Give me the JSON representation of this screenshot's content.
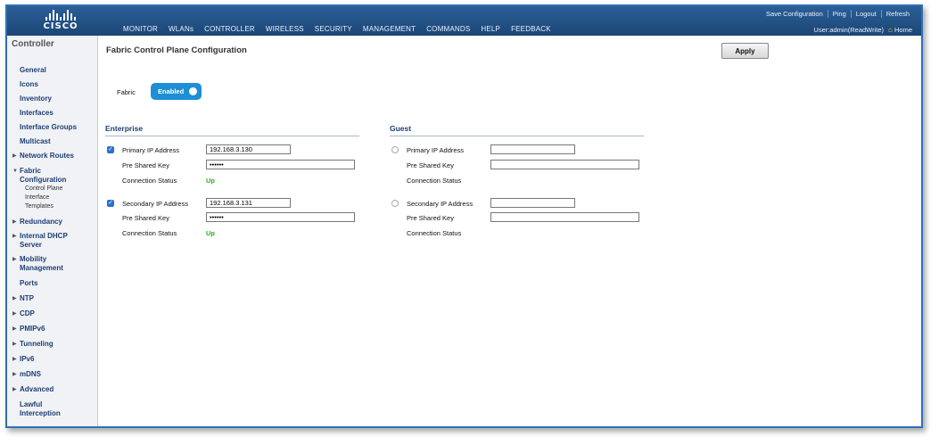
{
  "header": {
    "brand": "CISCO",
    "nav": [
      "MONITOR",
      "WLANs",
      "CONTROLLER",
      "WIRELESS",
      "SECURITY",
      "MANAGEMENT",
      "COMMANDS",
      "HELP",
      "FEEDBACK"
    ],
    "utility": [
      "Save Configuration",
      "Ping",
      "Logout",
      "Refresh"
    ],
    "user": "User:admin(ReadWrite)",
    "home": "Home"
  },
  "sidebar": {
    "title": "Controller",
    "items": [
      {
        "label": "General",
        "arrow": false
      },
      {
        "label": "Icons",
        "arrow": false
      },
      {
        "label": "Inventory",
        "arrow": false
      },
      {
        "label": "Interfaces",
        "arrow": false
      },
      {
        "label": "Interface Groups",
        "arrow": false
      },
      {
        "label": "Multicast",
        "arrow": false
      },
      {
        "label": "Network Routes",
        "arrow": true
      },
      {
        "label": "Fabric Configuration",
        "arrow": true,
        "expanded": true
      },
      {
        "label": "Redundancy",
        "arrow": true
      },
      {
        "label": "Internal DHCP Server",
        "arrow": true
      },
      {
        "label": "Mobility Management",
        "arrow": true
      },
      {
        "label": "Ports",
        "arrow": false
      },
      {
        "label": "NTP",
        "arrow": true
      },
      {
        "label": "CDP",
        "arrow": true
      },
      {
        "label": "PMIPv6",
        "arrow": true
      },
      {
        "label": "Tunneling",
        "arrow": true
      },
      {
        "label": "IPv6",
        "arrow": true
      },
      {
        "label": "mDNS",
        "arrow": true
      },
      {
        "label": "Advanced",
        "arrow": true
      },
      {
        "label": "Lawful Interception",
        "arrow": false
      }
    ],
    "subitems": [
      "Control Plane",
      "Interface",
      "Templates"
    ]
  },
  "main": {
    "title": "Fabric Control Plane Configuration",
    "apply_label": "Apply",
    "fabric_label": "Fabric",
    "fabric_toggle": "Enabled",
    "enterprise": {
      "title": "Enterprise",
      "primary_label": "Primary IP Address",
      "primary_ip": "192.168.3.130",
      "primary_key_label": "Pre Shared Key",
      "primary_key": "••••••",
      "primary_status_label": "Connection Status",
      "primary_status": "Up",
      "secondary_label": "Secondary IP Address",
      "secondary_ip": "192.168.3.131",
      "secondary_key_label": "Pre Shared Key",
      "secondary_key": "••••••",
      "secondary_status_label": "Connection Status",
      "secondary_status": "Up"
    },
    "guest": {
      "title": "Guest",
      "primary_label": "Primary IP Address",
      "primary_ip": "",
      "primary_key_label": "Pre Shared Key",
      "primary_key": "",
      "primary_status_label": "Connection Status",
      "secondary_label": "Secondary IP Address",
      "secondary_ip": "",
      "secondary_key_label": "Pre Shared Key",
      "secondary_key": "",
      "secondary_status_label": "Connection Status"
    }
  },
  "colors": {
    "header": "#1c4676",
    "accent": "#1e8fd6",
    "status_up": "#33aa22",
    "link": "#1d3f75"
  }
}
